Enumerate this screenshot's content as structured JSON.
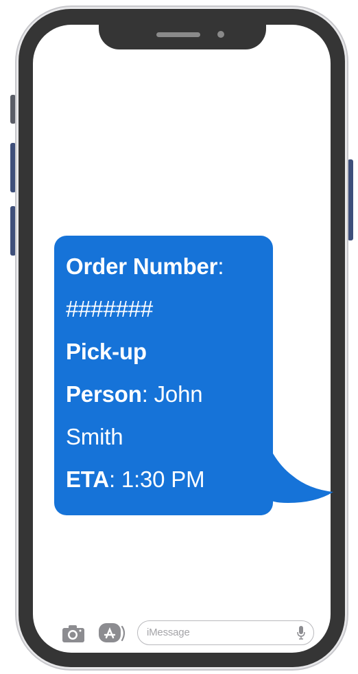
{
  "message": {
    "order_label": "Order Number",
    "order_colon": ":",
    "order_value": "#######",
    "pickup_label_1": "Pick-up",
    "pickup_label_2": "Person",
    "pickup_colon": ":",
    "pickup_value_1": " John",
    "pickup_value_2": "Smith",
    "eta_label": "ETA",
    "eta_colon": ":",
    "eta_value": " 1:30 PM",
    "bubble_color": "#1673d8"
  },
  "input_bar": {
    "placeholder": "iMessage",
    "icons": [
      "camera-icon",
      "app-store-icon",
      "microphone-icon"
    ]
  },
  "device": {
    "frame_color": "#353535",
    "button_color": "#3e4f7a"
  }
}
